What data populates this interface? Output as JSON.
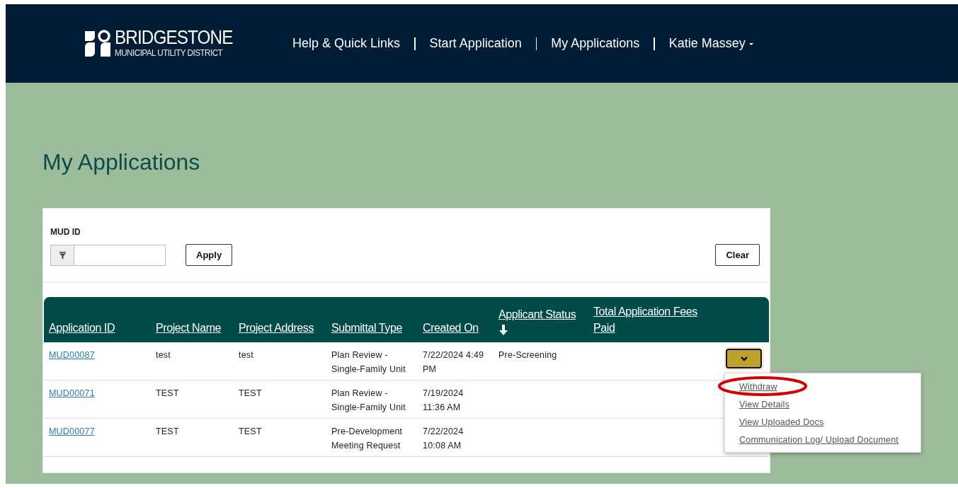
{
  "header": {
    "logo": {
      "name": "BRIDGESTONE",
      "subtitle": "MUNICIPAL UTILITY DISTRICT"
    },
    "nav": [
      {
        "label": "Help & Quick Links",
        "kind": "link"
      },
      {
        "label": "Start Application",
        "kind": "link"
      },
      {
        "label": "My Applications",
        "kind": "link"
      },
      {
        "label": "Katie Massey",
        "kind": "dropdown"
      }
    ]
  },
  "page_title": "My Applications",
  "filter": {
    "label": "MUD ID",
    "apply": "Apply",
    "clear": "Clear"
  },
  "table": {
    "columns": [
      {
        "label": "Application ID",
        "sort_icon": false
      },
      {
        "label": "Project Name",
        "sort_icon": false
      },
      {
        "label": "Project Address",
        "sort_icon": false
      },
      {
        "label": "Submittal Type",
        "sort_icon": false
      },
      {
        "label": "Created On",
        "sort_icon": false
      },
      {
        "label": "Applicant Status",
        "sort_icon": true
      },
      {
        "label": "Total Application Fees Paid",
        "sort_icon": false
      }
    ],
    "rows": [
      {
        "cells": [
          "MUD00087",
          "test",
          "test",
          "Plan Review - Single-Family Unit",
          "7/22/2024 4:49 PM",
          "Pre-Screening",
          ""
        ],
        "actions": {
          "expanded": true,
          "menu": [
            {
              "label": "Withdraw",
              "circled": true
            },
            {
              "label": "View Details",
              "circled": false
            },
            {
              "label": "View Uploaded Docs",
              "circled": false
            },
            {
              "label": "Communication Log/ Upload Document",
              "circled": false
            }
          ]
        }
      },
      {
        "cells": [
          "MUD00071",
          "TEST",
          "TEST",
          "Plan Review - Single-Family Unit",
          "7/19/2024 11:36 AM",
          "",
          ""
        ]
      },
      {
        "cells": [
          "MUD00077",
          "TEST",
          "TEST",
          "Pre-Development Meeting Request",
          "7/22/2024 10:08 AM",
          "",
          ""
        ]
      }
    ]
  }
}
